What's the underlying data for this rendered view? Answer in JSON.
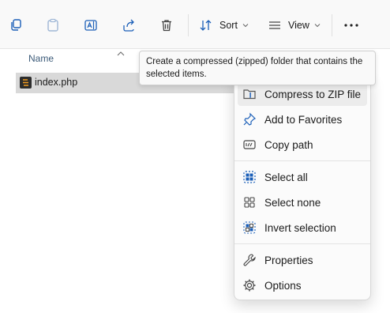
{
  "toolbar": {
    "sort_label": "Sort",
    "view_label": "View",
    "icons": [
      "copy-icon",
      "paste-icon",
      "rename-icon",
      "share-icon",
      "delete-icon",
      "sort-icon",
      "view-icon",
      "more-icon"
    ],
    "accent_color": "#1b5fb8"
  },
  "file_list": {
    "column_name": "Name",
    "files": [
      {
        "name": "index.php",
        "selected": true
      }
    ]
  },
  "tooltip": {
    "text": "Create a compressed (zipped) folder that contains the selected items."
  },
  "context_menu": {
    "items": [
      {
        "label": "Compress to ZIP file",
        "icon": "zip-icon",
        "hovered": true
      },
      {
        "label": "Add to Favorites",
        "icon": "pin-icon"
      },
      {
        "label": "Copy path",
        "icon": "copy-path-icon"
      },
      {
        "label": "Select all",
        "icon": "select-all-icon"
      },
      {
        "label": "Select none",
        "icon": "select-none-icon"
      },
      {
        "label": "Invert selection",
        "icon": "invert-selection-icon"
      },
      {
        "label": "Properties",
        "icon": "wrench-icon"
      },
      {
        "label": "Options",
        "icon": "gear-icon"
      }
    ]
  }
}
